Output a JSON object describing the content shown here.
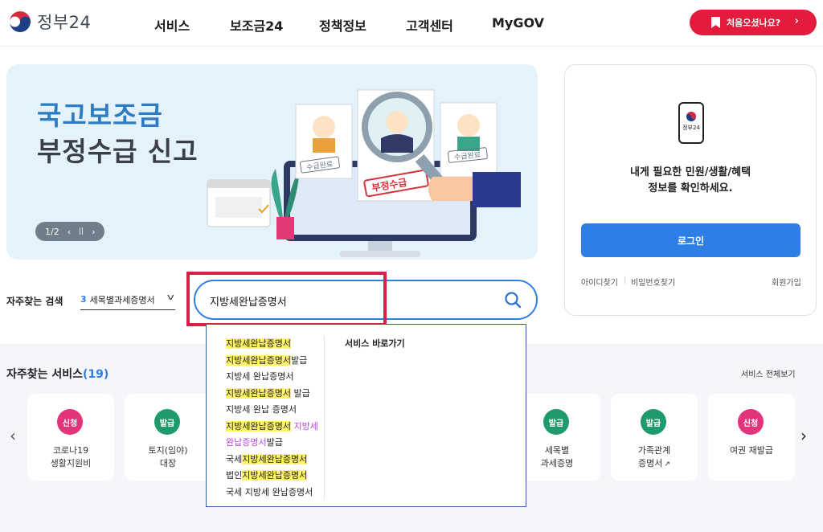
{
  "header": {
    "logo_text": "정부24",
    "nav": [
      "서비스",
      "보조금24",
      "정책정보",
      "고객센터",
      "MyGOV"
    ],
    "cta_label": "처음오셨나요?"
  },
  "banner": {
    "title_line1": "국고보조금",
    "title_line2": "부정수급 신고",
    "pager": "1/2",
    "stamp_left": "수급완료",
    "stamp_center": "부정수급",
    "stamp_right": "수급완료"
  },
  "login": {
    "icon_label": "정부24",
    "message_line1": "내게 필요한 민원/생활/혜택",
    "message_line2": "정보를 확인하세요.",
    "button": "로그인",
    "find_id": "아이디찾기",
    "find_pw": "비밀번호찾기",
    "signup": "회원가입"
  },
  "search": {
    "label": "자주찾는 검색",
    "select_num": "3",
    "select_text": "세목별과세증명서",
    "value": "지방세완납증명서"
  },
  "dropdown": {
    "section_title": "서비스 바로가기"
  },
  "services": {
    "title": "자주찾는 서비스",
    "count": "(19)",
    "view_all": "서비스 전체보기",
    "cards": [
      {
        "badge": "신청",
        "line1": "코로나19",
        "line2": "생활지원비"
      },
      {
        "badge": "발급",
        "line1": "토지(임야)",
        "line2": "대장"
      },
      {
        "badge": "발급",
        "line1": "세목별",
        "line2": "과세증명"
      },
      {
        "badge": "발급",
        "line1": "가족관계",
        "line2": "증명서"
      },
      {
        "badge": "신청",
        "line1": "여권 재발급",
        "line2": ""
      }
    ]
  },
  "colors": {
    "primary": "#2f7ee6",
    "cta": "#e31c3d",
    "highlight_box": "#d71f48",
    "badge_apply": "#e3337a",
    "badge_issue": "#1f9a6c"
  }
}
